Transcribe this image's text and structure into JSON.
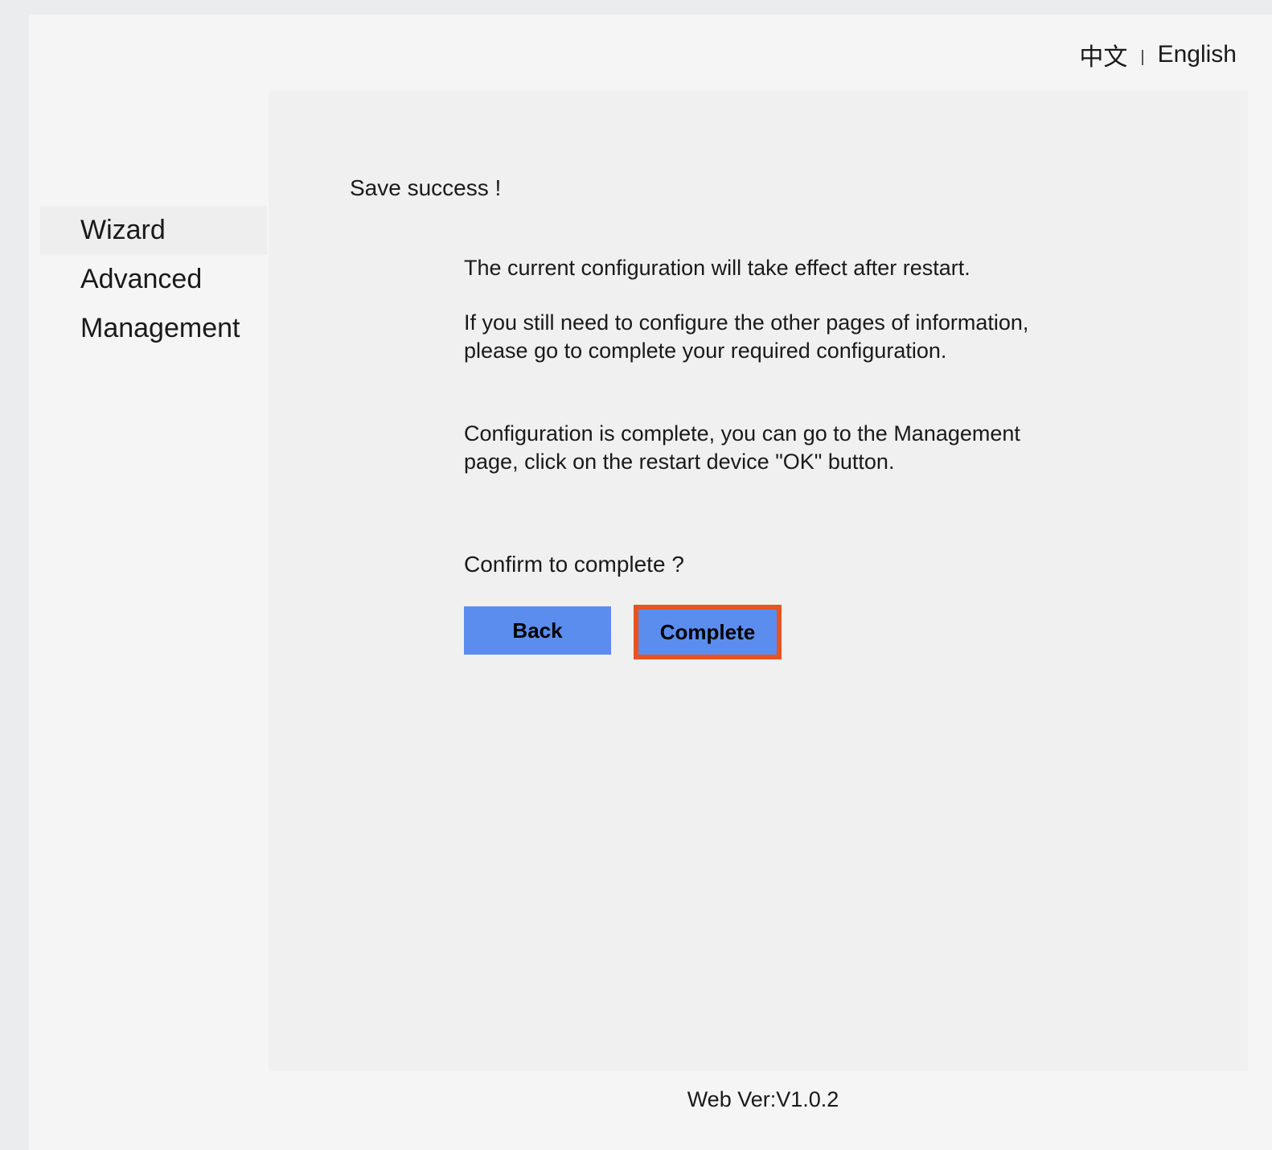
{
  "header": {
    "lang_chinese": "中文",
    "lang_separator": "|",
    "lang_english": "English"
  },
  "sidebar": {
    "items": [
      {
        "label": "Wizard",
        "active": true
      },
      {
        "label": "Advanced",
        "active": false
      },
      {
        "label": "Management",
        "active": false
      }
    ]
  },
  "main": {
    "save_message": "Save success !",
    "restart_message": "The current configuration will take effect after restart.",
    "configure_message": "If you still need to configure the other pages of information,  please go to complete your required configuration.",
    "complete_message": "Configuration is complete,  you can go to the Management page,  click on the restart device \"OK\" button.",
    "confirm_question": "Confirm to complete ?",
    "back_label": "Back",
    "complete_label": "Complete"
  },
  "footer": {
    "version": "Web Ver:V1.0.2"
  },
  "colors": {
    "button_bg": "#5b8def",
    "highlight_border": "#e8531f"
  }
}
